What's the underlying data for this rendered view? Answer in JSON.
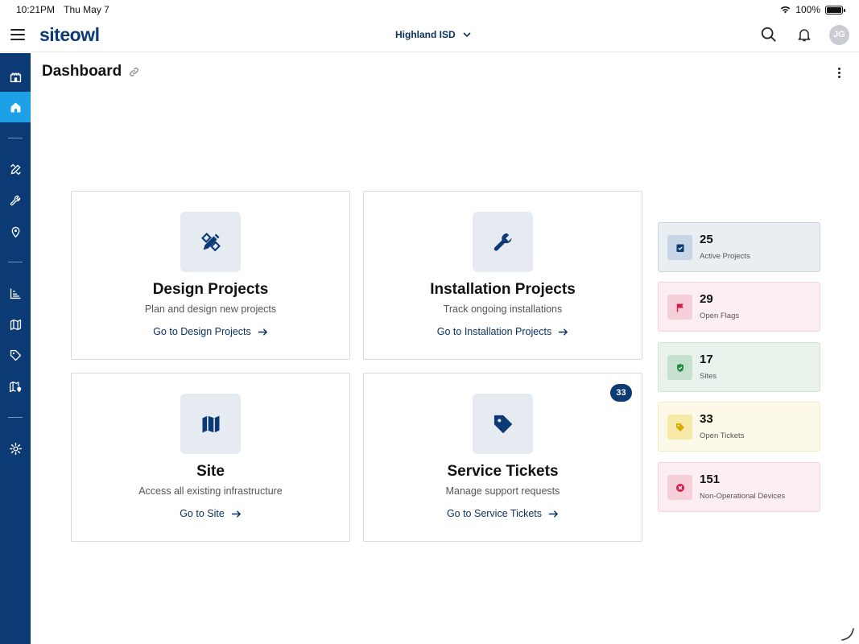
{
  "status_bar": {
    "time": "10:21PM",
    "date": "Thu May 7",
    "battery": "100%"
  },
  "header": {
    "logo": "siteowl",
    "organization": "Highland ISD",
    "avatar_initials": "JG"
  },
  "page": {
    "title": "Dashboard"
  },
  "cards": [
    {
      "title": "Design Projects",
      "subtitle": "Plan and design new projects",
      "link": "Go to Design Projects",
      "icon": "pencil-ruler-icon"
    },
    {
      "title": "Installation Projects",
      "subtitle": "Track ongoing installations",
      "link": "Go to Installation Projects",
      "icon": "wrench-icon"
    },
    {
      "title": "Site",
      "subtitle": "Access all existing infrastructure",
      "link": "Go to Site",
      "icon": "map-icon"
    },
    {
      "title": "Service Tickets",
      "subtitle": "Manage support requests",
      "link": "Go to Service Tickets",
      "icon": "tag-icon",
      "badge": "33"
    }
  ],
  "stats": [
    {
      "value": "25",
      "label": "Active Projects",
      "bg": "#e9eef3",
      "border": "#cbd6e2",
      "icon_bg": "#c7d5e6",
      "icon_color": "#0b3a74"
    },
    {
      "value": "29",
      "label": "Open Flags",
      "bg": "#fdeef2",
      "border": "#f5d3dc",
      "icon_bg": "#f6cfd8",
      "icon_color": "#d81b46"
    },
    {
      "value": "17",
      "label": "Sites",
      "bg": "#e9f3ec",
      "border": "#cde3d4",
      "icon_bg": "#c6e2cf",
      "icon_color": "#1e8a3e"
    },
    {
      "value": "33",
      "label": "Open Tickets",
      "bg": "#fdf9e8",
      "border": "#f3ebc6",
      "icon_bg": "#f7e9a8",
      "icon_color": "#d6a800"
    },
    {
      "value": "151",
      "label": "Non-Operational Devices",
      "bg": "#fdeef2",
      "border": "#f5d3dc",
      "icon_bg": "#f6cfd8",
      "icon_color": "#d81b46"
    }
  ],
  "colors": {
    "brand": "#0b3a74",
    "sidebar_active": "#1ea0e6"
  }
}
